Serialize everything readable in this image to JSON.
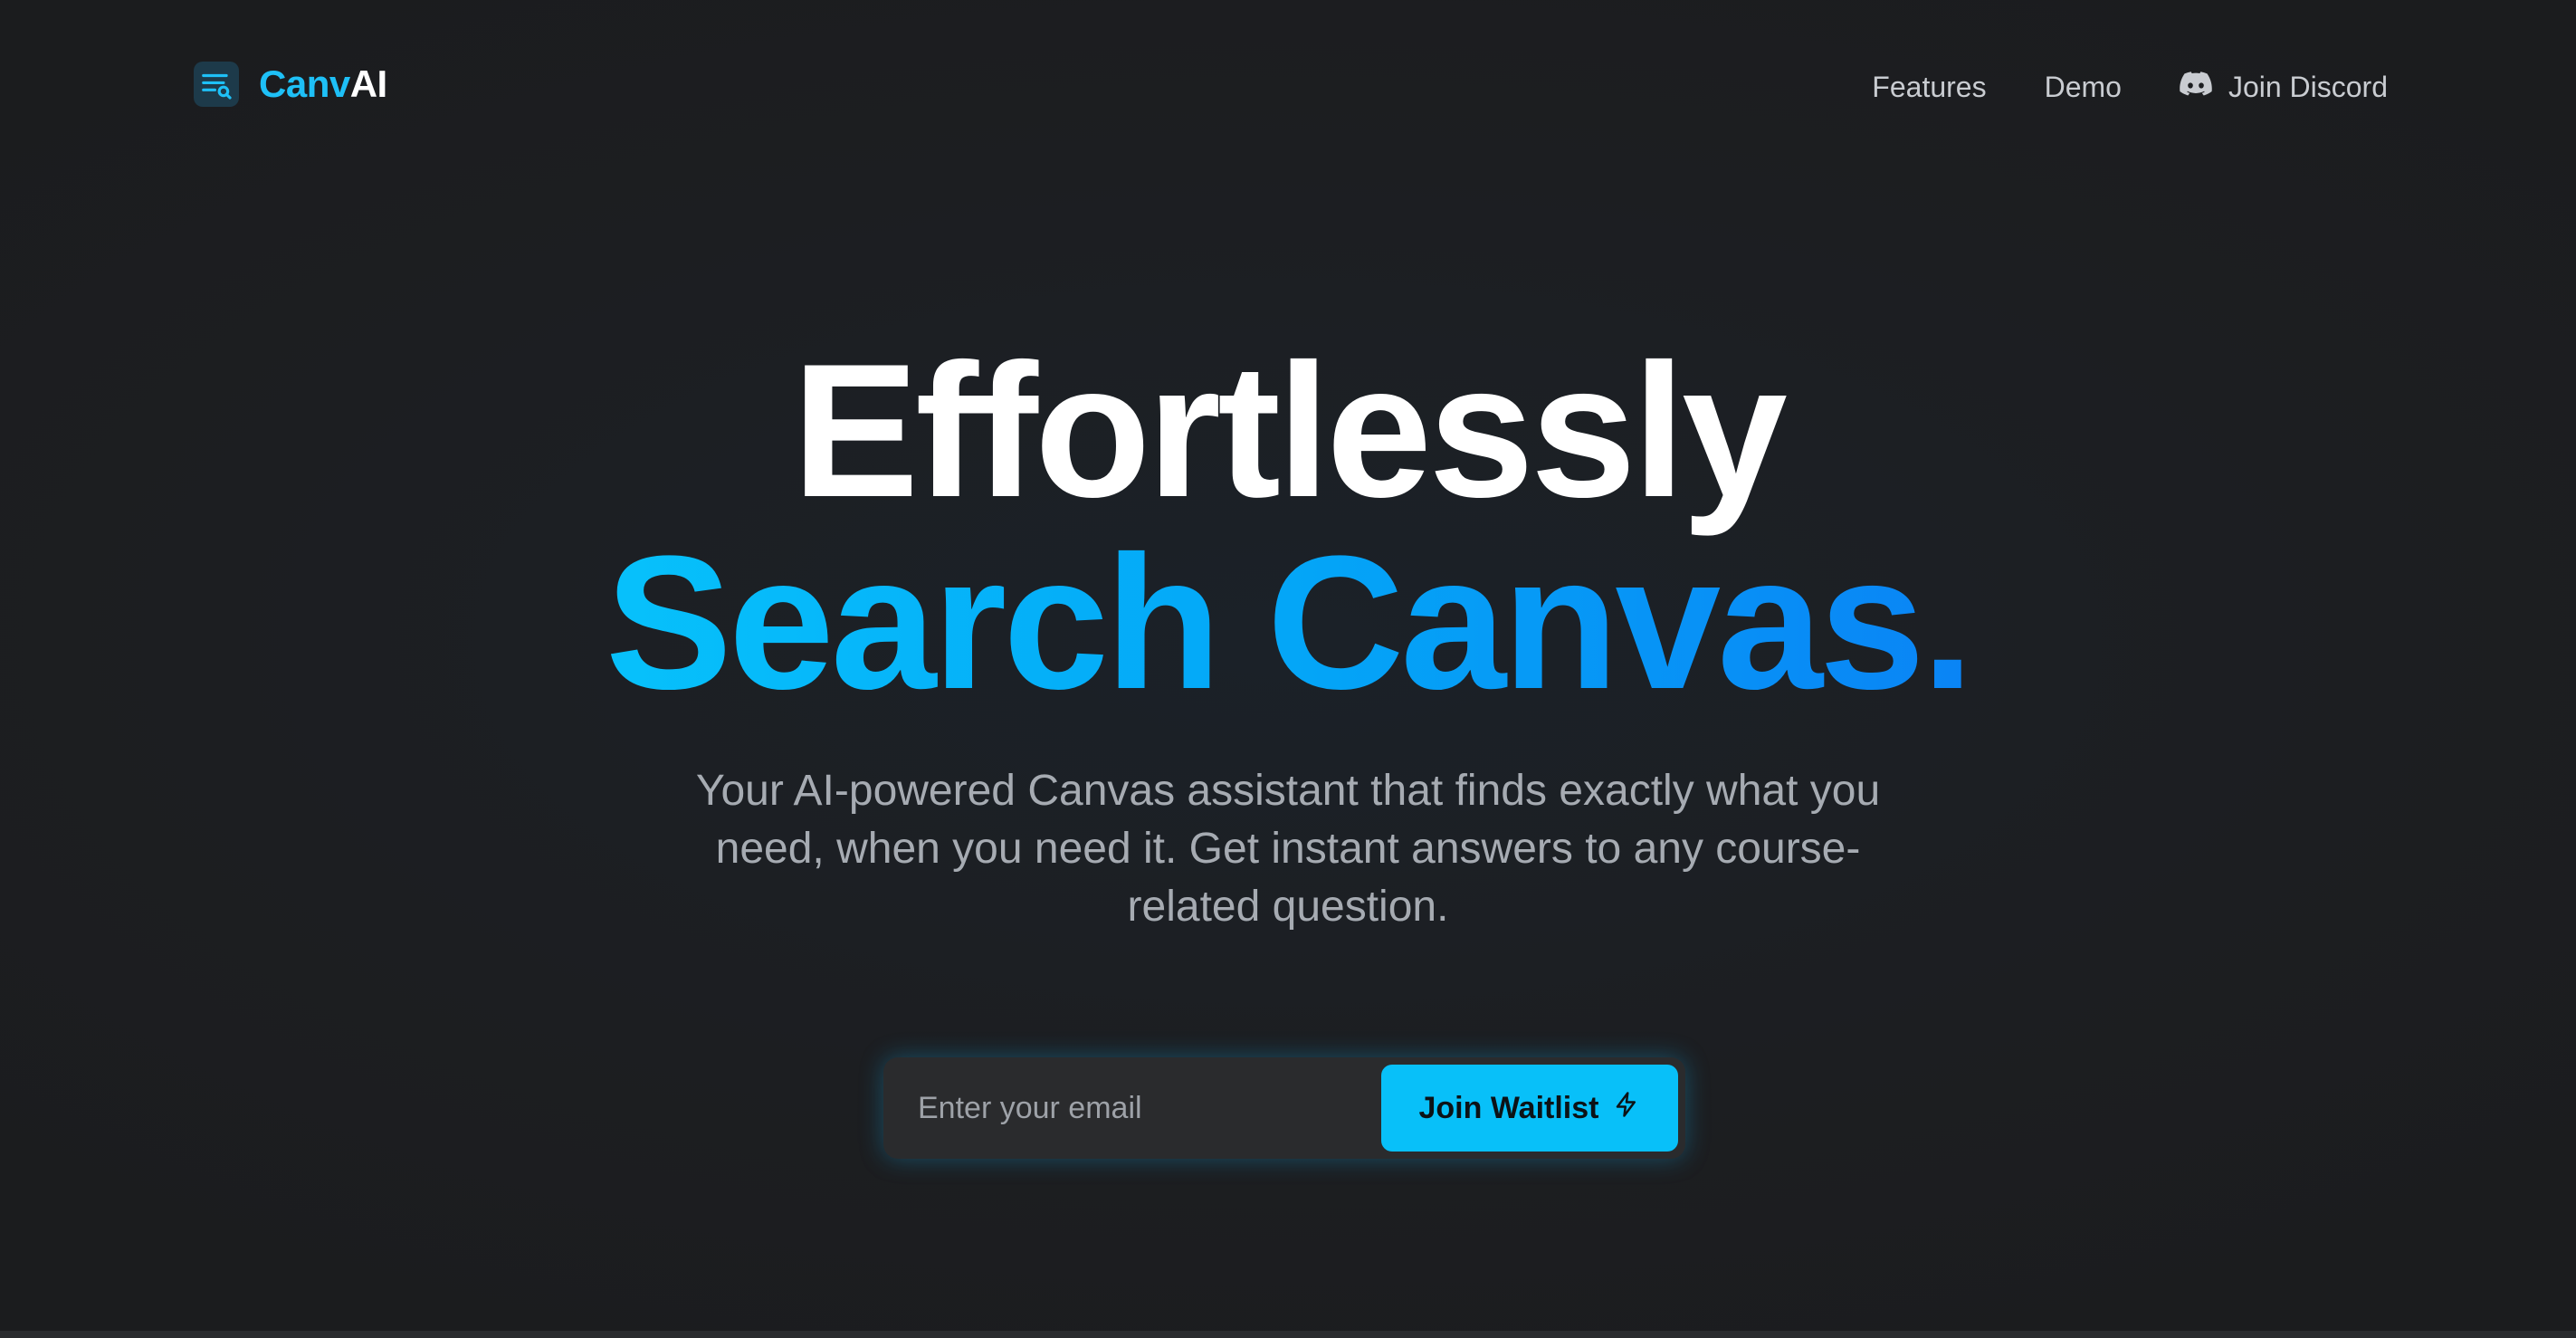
{
  "header": {
    "logo": {
      "part1": "Canv",
      "part2": "AI",
      "icon": "search-list-icon"
    },
    "nav": [
      {
        "label": "Features"
      },
      {
        "label": "Demo"
      },
      {
        "label": "Join Discord",
        "icon": "discord-icon"
      }
    ]
  },
  "hero": {
    "title_line1": "Effortlessly",
    "title_line2": "Search Canvas.",
    "subtitle": "Your AI-powered Canvas assistant that finds exactly what you need, when you need it. Get instant answers to any course-related question.",
    "email_placeholder": "Enter your email",
    "email_value": "",
    "cta_label": "Join Waitlist",
    "cta_icon": "lightning-icon"
  },
  "colors": {
    "accent": "#08c0f9",
    "accent_blue": "#0a84f5",
    "background": "#1c1d1f"
  }
}
